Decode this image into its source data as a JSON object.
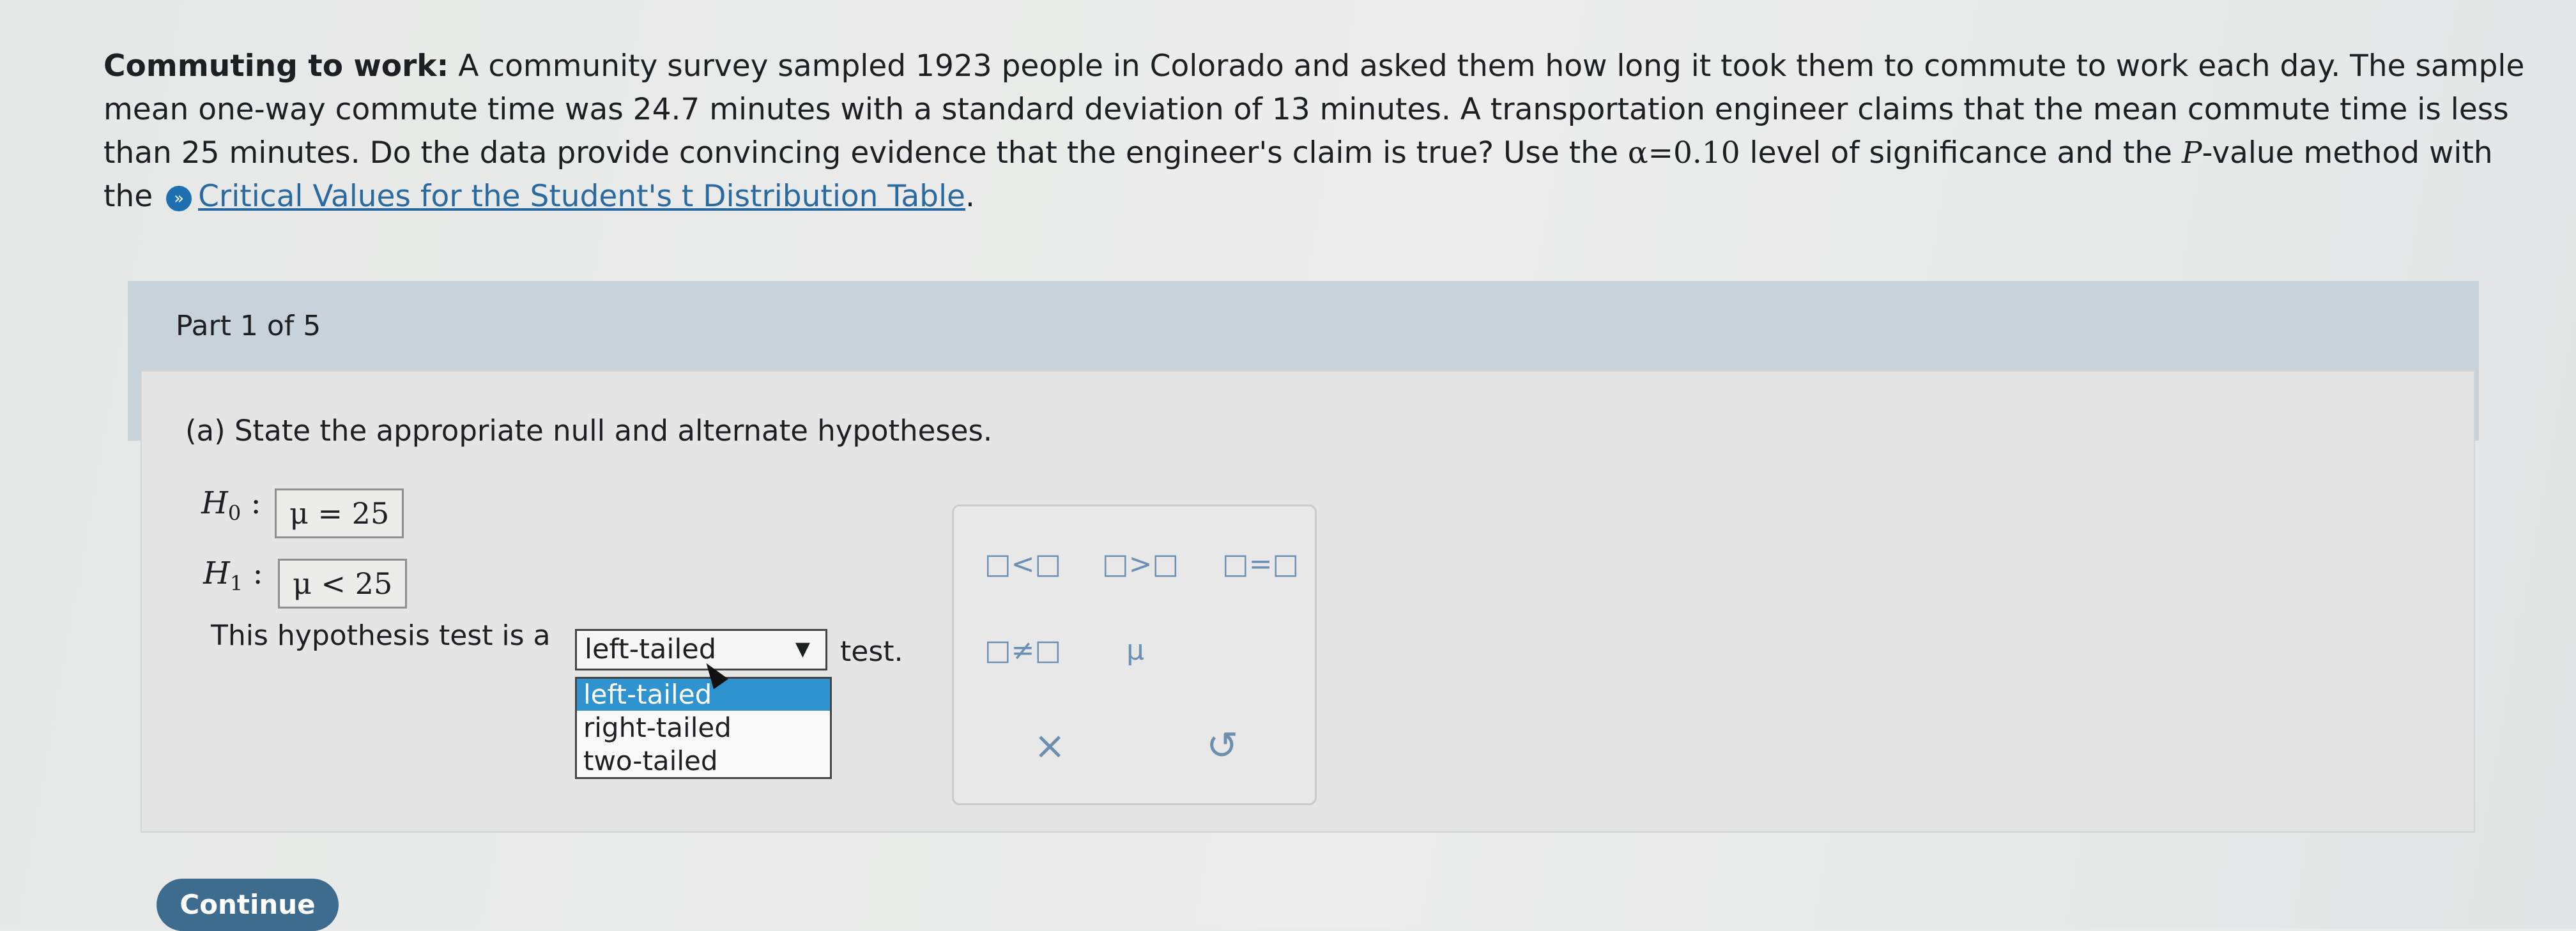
{
  "problem": {
    "title": "Commuting to work:",
    "line1": " A community survey sampled 1923 people in Colorado and asked them how long it took them to commute to work each day. The sample",
    "line2": "mean one-way commute time was 24.7 minutes with a standard deviation of 13 minutes. A transportation engineer claims that the mean commute time is less",
    "line3": "than 25 minutes. Do the data provide convincing evidence that the engineer's claim is true? Use the ",
    "alpha_expr": "α=0.10",
    "line3b": " level of significance and the ",
    "p_letter": "P",
    "line3c": "-value method with",
    "line4_prefix": "the ",
    "link_text": "Critical Values for the Student's t Distribution Table",
    "line4_suffix": "."
  },
  "part": {
    "label": "Part 1 of 5"
  },
  "question": {
    "prompt": "(a) State the appropriate null and alternate hypotheses."
  },
  "h0": {
    "letter": "H",
    "sub": "0",
    "colon": ":",
    "value": "μ = 25"
  },
  "h1": {
    "letter": "H",
    "sub": "1",
    "colon": ":",
    "value": "μ < 25"
  },
  "test": {
    "prefix": "This hypothesis test is a",
    "selected": "left-tailed",
    "suffix": "test.",
    "options": [
      "left-tailed",
      "right-tailed",
      "two-tailed"
    ]
  },
  "palette": {
    "less": "□<□",
    "greater": "□>□",
    "equal": "□=□",
    "not_equal": "□≠□",
    "mu": "μ",
    "clear": "×",
    "undo": "↺"
  },
  "continue_label": "Continue"
}
